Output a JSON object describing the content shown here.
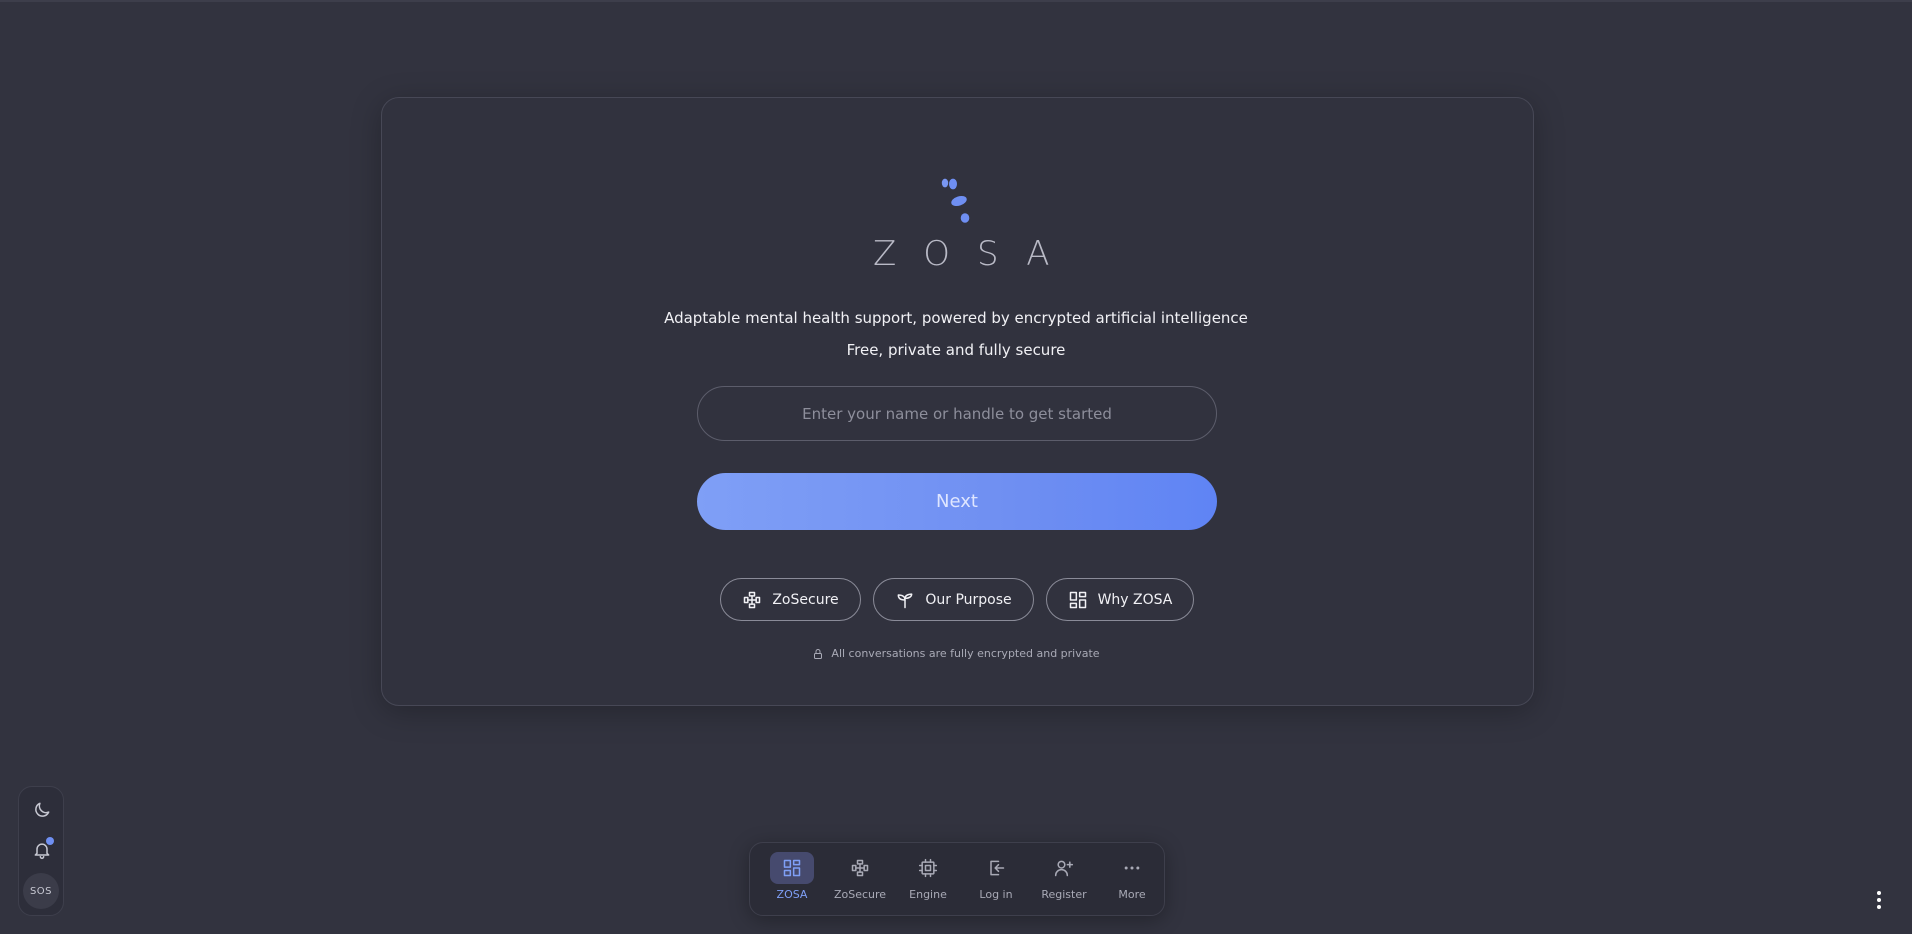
{
  "brand": {
    "name": "ZOSA",
    "accent_color": "#6f8ff2",
    "tagline": "Adaptable mental health support, powered by encrypted artificial intelligence",
    "subtagline": "Free, private and fully secure"
  },
  "form": {
    "name_placeholder": "Enter your name or handle to get started",
    "name_value": "",
    "next_label": "Next"
  },
  "links": [
    {
      "label": "ZoSecure",
      "icon": "zosecure-icon"
    },
    {
      "label": "Our Purpose",
      "icon": "sprout-icon"
    },
    {
      "label": "Why ZOSA",
      "icon": "grid-icon"
    }
  ],
  "encryption_note": "All conversations are fully encrypted and private",
  "side_dock": {
    "theme_icon": "moon-icon",
    "notifications_icon": "bell-icon",
    "has_notification": true,
    "sos_label": "SOS"
  },
  "bottom_nav": {
    "active_index": 0,
    "items": [
      {
        "label": "ZOSA",
        "icon": "dashboard-icon"
      },
      {
        "label": "ZoSecure",
        "icon": "zosecure-icon"
      },
      {
        "label": "Engine",
        "icon": "cpu-icon"
      },
      {
        "label": "Log in",
        "icon": "login-icon"
      },
      {
        "label": "Register",
        "icon": "user-plus-icon"
      },
      {
        "label": "More",
        "icon": "more-icon"
      }
    ]
  }
}
